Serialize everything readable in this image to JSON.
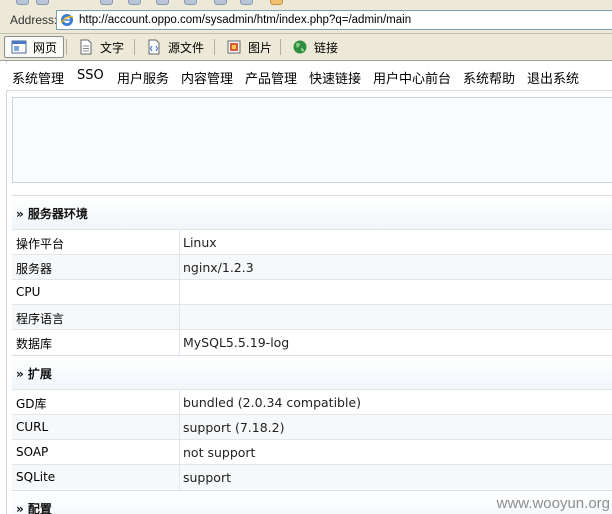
{
  "address_bar": {
    "label": "Address:",
    "url": "http://account.oppo.com/sysadmin/htm/index.php?q=/admin/main"
  },
  "view_tabs": [
    {
      "label": "网页",
      "icon": "webpage-icon",
      "active": true
    },
    {
      "label": "文字",
      "icon": "text-doc-icon",
      "active": false
    },
    {
      "label": "源文件",
      "icon": "source-file-icon",
      "active": false
    },
    {
      "label": "图片",
      "icon": "image-icon",
      "active": false
    },
    {
      "label": "链接",
      "icon": "link-globe-icon",
      "active": false
    }
  ],
  "menu": [
    "系统管理",
    "SSO",
    "用户服务",
    "内容管理",
    "产品管理",
    "快速链接",
    "用户中心前台",
    "系统帮助",
    "退出系统"
  ],
  "sections": {
    "server": {
      "title": "» 服务器环境",
      "rows": [
        {
          "key": "操作平台",
          "value": "Linux"
        },
        {
          "key": "服务器",
          "value": "nginx/1.2.3"
        },
        {
          "key": "CPU",
          "value": ""
        },
        {
          "key": "程序语言",
          "value": ""
        },
        {
          "key": "数据库",
          "value": "MySQL5.5.19-log"
        }
      ]
    },
    "extensions": {
      "title": "» 扩展",
      "rows": [
        {
          "key": "GD库",
          "value": "bundled (2.0.34 compatible)"
        },
        {
          "key": "CURL",
          "value": "support (7.18.2)"
        },
        {
          "key": "SOAP",
          "value": "not support"
        },
        {
          "key": "SQLite",
          "value": "support"
        }
      ]
    },
    "config": {
      "title": "» 配置"
    }
  },
  "watermark": "www.wooyun.org",
  "colors": {
    "chrome": "#ece9d8",
    "section_bg": "#f1f6fb",
    "border": "#e2e6ea"
  }
}
